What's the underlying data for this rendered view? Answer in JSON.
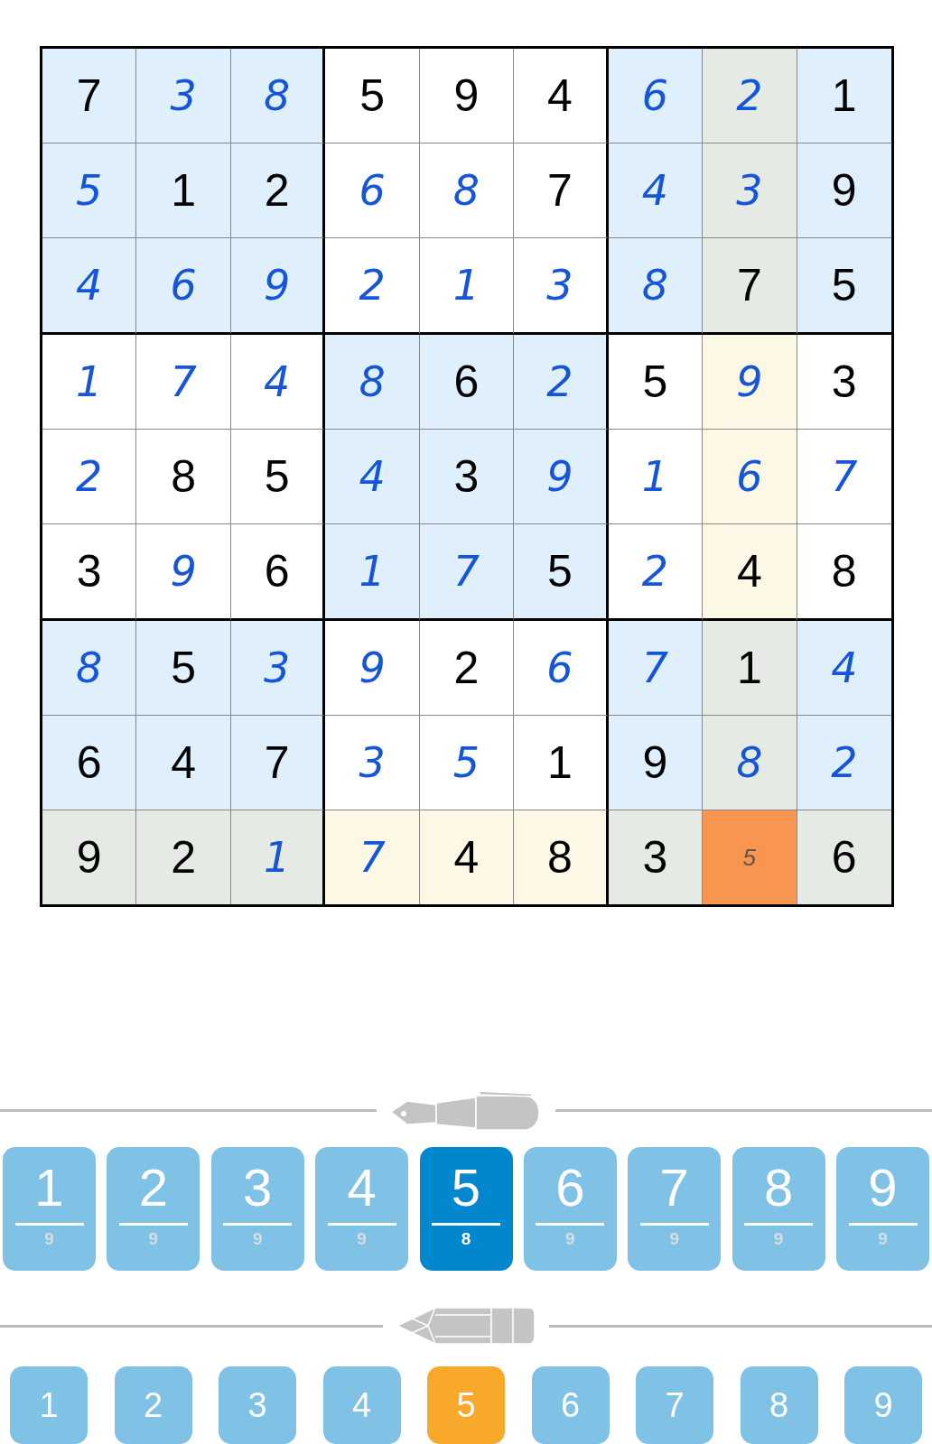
{
  "grid": [
    {
      "cells": [
        {
          "value": "7",
          "kind": "given",
          "selected": false
        },
        {
          "value": "3",
          "kind": "entered",
          "selected": false
        },
        {
          "value": "8",
          "kind": "entered",
          "selected": false
        },
        {
          "value": "5",
          "kind": "given",
          "selected": false
        },
        {
          "value": "9",
          "kind": "given",
          "selected": false
        },
        {
          "value": "4",
          "kind": "given",
          "selected": false
        },
        {
          "value": "6",
          "kind": "entered",
          "selected": false
        },
        {
          "value": "2",
          "kind": "entered",
          "selected": false
        },
        {
          "value": "1",
          "kind": "given",
          "selected": false
        }
      ]
    },
    {
      "cells": [
        {
          "value": "5",
          "kind": "entered",
          "selected": false
        },
        {
          "value": "1",
          "kind": "given",
          "selected": false
        },
        {
          "value": "2",
          "kind": "given",
          "selected": false
        },
        {
          "value": "6",
          "kind": "entered",
          "selected": false
        },
        {
          "value": "8",
          "kind": "entered",
          "selected": false
        },
        {
          "value": "7",
          "kind": "given",
          "selected": false
        },
        {
          "value": "4",
          "kind": "entered",
          "selected": false
        },
        {
          "value": "3",
          "kind": "entered",
          "selected": false
        },
        {
          "value": "9",
          "kind": "given",
          "selected": false
        }
      ]
    },
    {
      "cells": [
        {
          "value": "4",
          "kind": "entered",
          "selected": false
        },
        {
          "value": "6",
          "kind": "entered",
          "selected": false
        },
        {
          "value": "9",
          "kind": "entered",
          "selected": false
        },
        {
          "value": "2",
          "kind": "entered",
          "selected": false
        },
        {
          "value": "1",
          "kind": "entered",
          "selected": false
        },
        {
          "value": "3",
          "kind": "entered",
          "selected": false
        },
        {
          "value": "8",
          "kind": "entered",
          "selected": false
        },
        {
          "value": "7",
          "kind": "given",
          "selected": false
        },
        {
          "value": "5",
          "kind": "given",
          "selected": false
        }
      ]
    },
    {
      "cells": [
        {
          "value": "1",
          "kind": "entered",
          "selected": false
        },
        {
          "value": "7",
          "kind": "entered",
          "selected": false
        },
        {
          "value": "4",
          "kind": "entered",
          "selected": false
        },
        {
          "value": "8",
          "kind": "entered",
          "selected": false
        },
        {
          "value": "6",
          "kind": "given",
          "selected": false
        },
        {
          "value": "2",
          "kind": "entered",
          "selected": false
        },
        {
          "value": "5",
          "kind": "given",
          "selected": false
        },
        {
          "value": "9",
          "kind": "entered",
          "selected": false
        },
        {
          "value": "3",
          "kind": "given",
          "selected": false
        }
      ]
    },
    {
      "cells": [
        {
          "value": "2",
          "kind": "entered",
          "selected": false
        },
        {
          "value": "8",
          "kind": "given",
          "selected": false
        },
        {
          "value": "5",
          "kind": "given",
          "selected": false
        },
        {
          "value": "4",
          "kind": "entered",
          "selected": false
        },
        {
          "value": "3",
          "kind": "given",
          "selected": false
        },
        {
          "value": "9",
          "kind": "entered",
          "selected": false
        },
        {
          "value": "1",
          "kind": "entered",
          "selected": false
        },
        {
          "value": "6",
          "kind": "entered",
          "selected": false
        },
        {
          "value": "7",
          "kind": "entered",
          "selected": false
        }
      ]
    },
    {
      "cells": [
        {
          "value": "3",
          "kind": "given",
          "selected": false
        },
        {
          "value": "9",
          "kind": "entered",
          "selected": false
        },
        {
          "value": "6",
          "kind": "given",
          "selected": false
        },
        {
          "value": "1",
          "kind": "entered",
          "selected": false
        },
        {
          "value": "7",
          "kind": "entered",
          "selected": false
        },
        {
          "value": "5",
          "kind": "given",
          "selected": false
        },
        {
          "value": "2",
          "kind": "entered",
          "selected": false
        },
        {
          "value": "4",
          "kind": "given",
          "selected": false
        },
        {
          "value": "8",
          "kind": "given",
          "selected": false
        }
      ]
    },
    {
      "cells": [
        {
          "value": "8",
          "kind": "entered",
          "selected": false
        },
        {
          "value": "5",
          "kind": "given",
          "selected": false
        },
        {
          "value": "3",
          "kind": "entered",
          "selected": false
        },
        {
          "value": "9",
          "kind": "entered",
          "selected": false
        },
        {
          "value": "2",
          "kind": "given",
          "selected": false
        },
        {
          "value": "6",
          "kind": "entered",
          "selected": false
        },
        {
          "value": "7",
          "kind": "entered",
          "selected": false
        },
        {
          "value": "1",
          "kind": "given",
          "selected": false
        },
        {
          "value": "4",
          "kind": "entered",
          "selected": false
        }
      ]
    },
    {
      "cells": [
        {
          "value": "6",
          "kind": "given",
          "selected": false
        },
        {
          "value": "4",
          "kind": "given",
          "selected": false
        },
        {
          "value": "7",
          "kind": "given",
          "selected": false
        },
        {
          "value": "3",
          "kind": "entered",
          "selected": false
        },
        {
          "value": "5",
          "kind": "entered",
          "selected": false
        },
        {
          "value": "1",
          "kind": "given",
          "selected": false
        },
        {
          "value": "9",
          "kind": "given",
          "selected": false
        },
        {
          "value": "8",
          "kind": "entered",
          "selected": false
        },
        {
          "value": "2",
          "kind": "entered",
          "selected": false
        }
      ]
    },
    {
      "cells": [
        {
          "value": "9",
          "kind": "given",
          "selected": false
        },
        {
          "value": "2",
          "kind": "given",
          "selected": false
        },
        {
          "value": "1",
          "kind": "entered",
          "selected": false
        },
        {
          "value": "7",
          "kind": "entered",
          "selected": false
        },
        {
          "value": "4",
          "kind": "given",
          "selected": false
        },
        {
          "value": "8",
          "kind": "given",
          "selected": false
        },
        {
          "value": "3",
          "kind": "given",
          "selected": false
        },
        {
          "value": "5",
          "kind": "note",
          "selected": true
        },
        {
          "value": "6",
          "kind": "given",
          "selected": false
        }
      ]
    }
  ],
  "pen_keys": [
    {
      "label": "1",
      "count": "9",
      "selected": false
    },
    {
      "label": "2",
      "count": "9",
      "selected": false
    },
    {
      "label": "3",
      "count": "9",
      "selected": false
    },
    {
      "label": "4",
      "count": "9",
      "selected": false
    },
    {
      "label": "5",
      "count": "8",
      "selected": true
    },
    {
      "label": "6",
      "count": "9",
      "selected": false
    },
    {
      "label": "7",
      "count": "9",
      "selected": false
    },
    {
      "label": "8",
      "count": "9",
      "selected": false
    },
    {
      "label": "9",
      "count": "9",
      "selected": false
    }
  ],
  "pencil_keys": [
    {
      "label": "1",
      "selected": false
    },
    {
      "label": "2",
      "selected": false
    },
    {
      "label": "3",
      "selected": false
    },
    {
      "label": "4",
      "selected": false
    },
    {
      "label": "5",
      "selected": true
    },
    {
      "label": "6",
      "selected": false
    },
    {
      "label": "7",
      "selected": false
    },
    {
      "label": "8",
      "selected": false
    },
    {
      "label": "9",
      "selected": false
    }
  ]
}
